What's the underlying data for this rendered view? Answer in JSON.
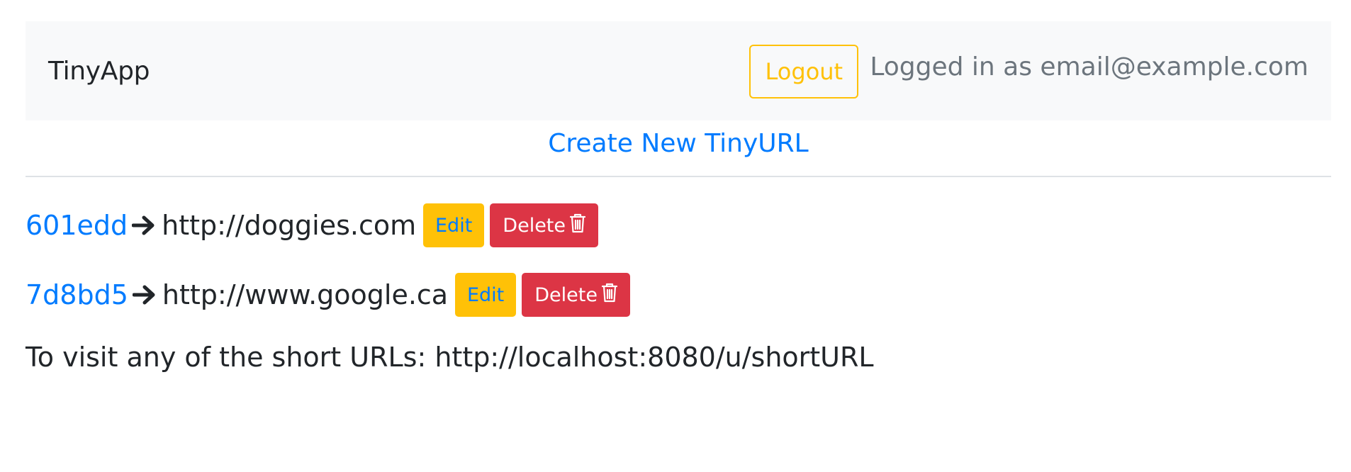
{
  "navbar": {
    "brand": "TinyApp",
    "logout_label": "Logout",
    "logged_in_text": "Logged in as email@example.com"
  },
  "create_link": "Create New TinyURL",
  "urls": [
    {
      "short": "601edd",
      "long": "http://doggies.com",
      "edit_label": "Edit",
      "delete_label": "Delete",
      "arrow_icon": "arrow-right-icon",
      "trash_icon": "trash-icon"
    },
    {
      "short": "7d8bd5",
      "long": "http://www.google.ca",
      "edit_label": "Edit",
      "delete_label": "Delete",
      "arrow_icon": "arrow-right-icon",
      "trash_icon": "trash-icon"
    }
  ],
  "footer_note": "To visit any of the short URLs: http://localhost:8080/u/shortURL",
  "colors": {
    "primary": "#007bff",
    "warning": "#ffc107",
    "danger": "#dc3545",
    "muted": "#6c757d",
    "navbar_bg": "#f8f9fa"
  }
}
